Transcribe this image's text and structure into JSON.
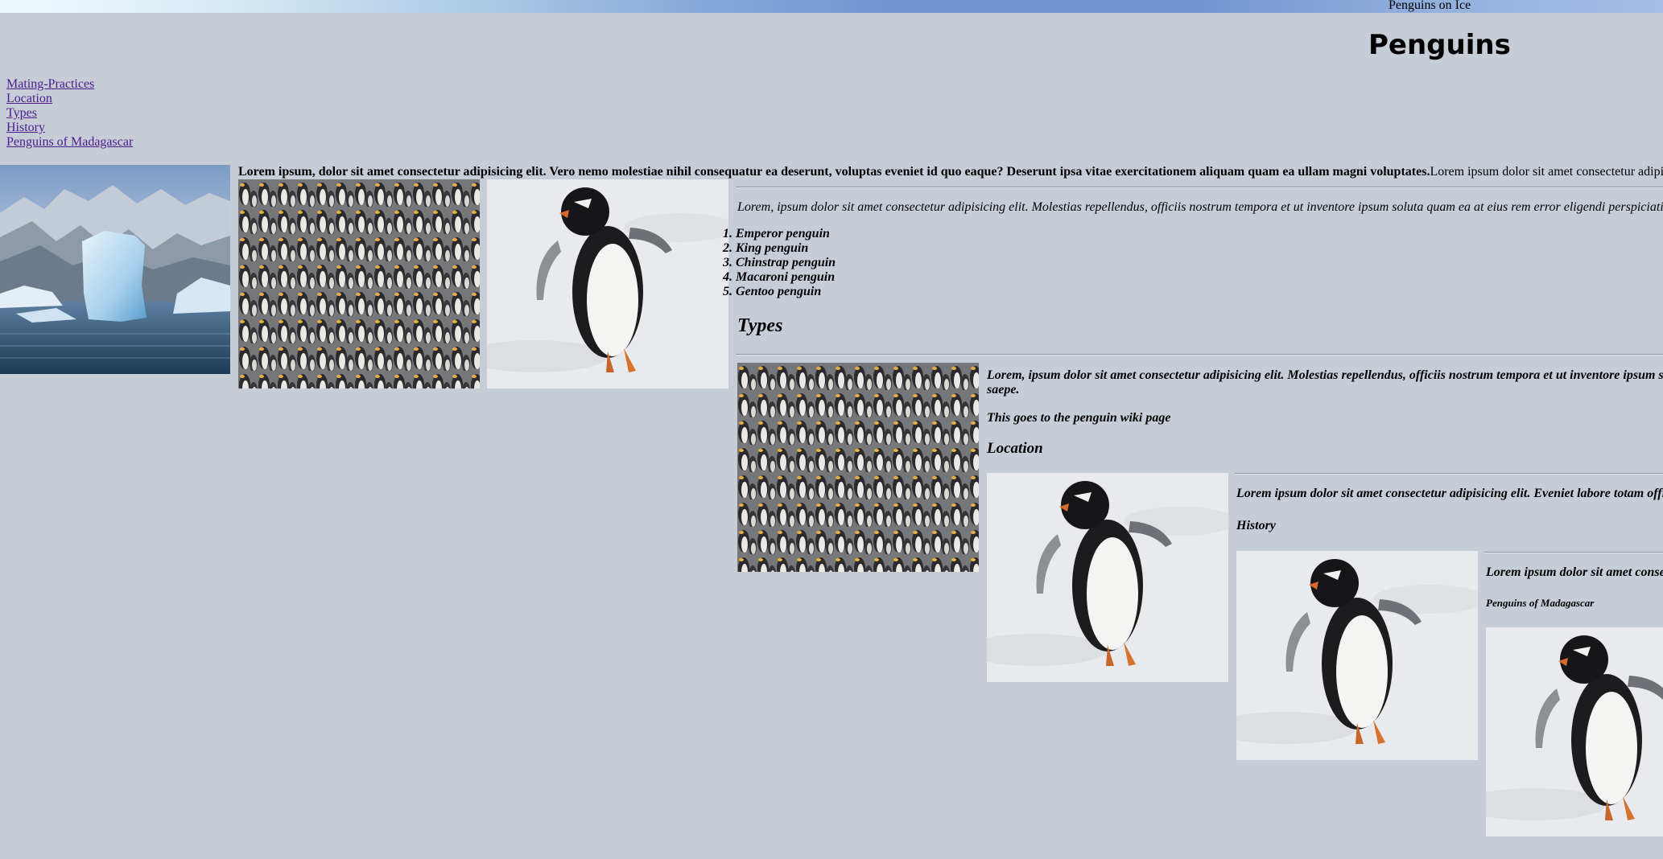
{
  "banner": {
    "text": "Penguins on Ice"
  },
  "title": "Penguins",
  "nav": [
    {
      "label": "Mating-Practices"
    },
    {
      "label": "Location"
    },
    {
      "label": "Types"
    },
    {
      "label": "History"
    },
    {
      "label": "Penguins of Madagascar"
    }
  ],
  "intro": {
    "bold": "Lorem ipsum, dolor sit amet consectetur adipisicing elit. Vero nemo molestiae nihil consequatur ea deserunt, voluptas eveniet id quo eaque? Deserunt ipsa vitae exercitationem aliquam quam ea ullam magni voluptates.",
    "normal": "Lorem ipsum dolor sit amet consectetur adipi"
  },
  "mating": {
    "paragraph": "Lorem, ipsum dolor sit amet consectetur adipisicing elit. Molestias repellendus, officiis nostrum tempora et ut inventore ipsum soluta quam ea at eius rem error eligendi perspiciati",
    "list": [
      "1. Emperor penguin",
      "2. King penguin",
      "3. Chinstrap penguin",
      "4. Macaroni penguin",
      "5. Gentoo penguin"
    ]
  },
  "types": {
    "heading": "Types",
    "paragraph_line1": "Lorem, ipsum dolor sit amet consectetur adipisicing elit. Molestias repellendus, officiis nostrum tempora et ut inventore ipsum s",
    "paragraph_line2": "saepe.",
    "wiki_text": "This goes to the penguin wiki page"
  },
  "location": {
    "heading": "Location",
    "paragraph": "Lorem ipsum dolor sit amet consectetur adipisicing elit. Eveniet labore totam offi"
  },
  "history": {
    "heading": "History",
    "paragraph": "Lorem ipsum dolor sit amet conse"
  },
  "madagascar": {
    "heading": "Penguins of Madagascar"
  },
  "colors": {
    "background": "#c7cdd7",
    "link": "#4b1b8e"
  },
  "images": {
    "iceberg": "iceberg-photo",
    "colony": "king-penguin-colony-photo",
    "gentoo": "gentoo-penguin-photo"
  }
}
